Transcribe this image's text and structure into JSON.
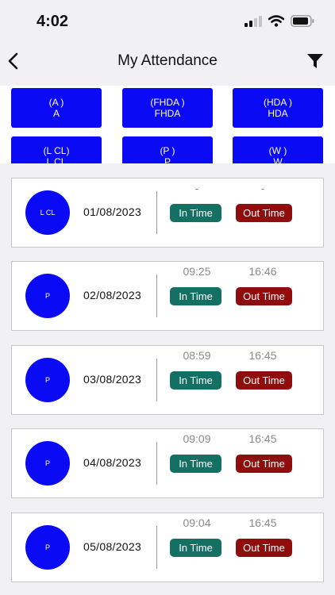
{
  "status_bar": {
    "time": "4:02"
  },
  "header": {
    "title": "My Attendance"
  },
  "legend": [
    {
      "code": "(A )",
      "label": "A"
    },
    {
      "code": "(FHDA )",
      "label": "FHDA"
    },
    {
      "code": "(HDA )",
      "label": "HDA"
    },
    {
      "code": "(L CL)",
      "label": "L CL"
    },
    {
      "code": "(P )",
      "label": "P"
    },
    {
      "code": "(W )",
      "label": "W"
    }
  ],
  "records": [
    {
      "status": "L CL",
      "date": "01/08/2023",
      "in_time": "-",
      "out_time": "-",
      "in_label": "In Time",
      "out_label": "Out Time"
    },
    {
      "status": "P",
      "date": "02/08/2023",
      "in_time": "09:25",
      "out_time": "16:46",
      "in_label": "In Time",
      "out_label": "Out Time"
    },
    {
      "status": "P",
      "date": "03/08/2023",
      "in_time": "08:59",
      "out_time": "16:45",
      "in_label": "In Time",
      "out_label": "Out Time"
    },
    {
      "status": "P",
      "date": "04/08/2023",
      "in_time": "09:09",
      "out_time": "16:45",
      "in_label": "In Time",
      "out_label": "Out Time"
    },
    {
      "status": "P",
      "date": "05/08/2023",
      "in_time": "09:04",
      "out_time": "16:45",
      "in_label": "In Time",
      "out_label": "Out Time"
    }
  ],
  "colors": {
    "status_blue": "#0a0af5",
    "in_time_green": "#147063",
    "out_time_red": "#8f0d0d"
  },
  "icons": [
    "signal-icon",
    "wifi-icon",
    "battery-icon",
    "back-chevron-icon",
    "filter-icon"
  ]
}
